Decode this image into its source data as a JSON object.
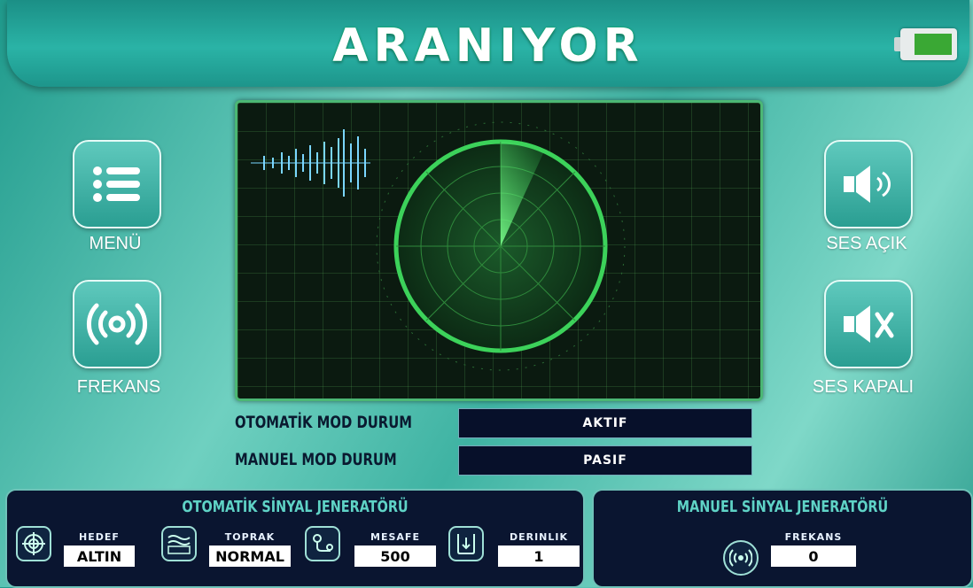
{
  "header": {
    "title": "ARANIYOR"
  },
  "buttons": {
    "menu": "MENÜ",
    "frequency": "FREKANS",
    "sound_on": "SES AÇIK",
    "sound_off": "SES KAPALI"
  },
  "status": {
    "auto_label": "OTOMATİK MOD DURUM",
    "auto_value": "AKTIF",
    "manual_label": "MANUEL MOD DURUM",
    "manual_value": "PASIF"
  },
  "auto_panel": {
    "title": "OTOMATİK SİNYAL JENERATÖRÜ",
    "items": [
      {
        "label": "HEDEF",
        "value": "ALTIN",
        "icon": "target-icon"
      },
      {
        "label": "TOPRAK",
        "value": "NORMAL",
        "icon": "soil-icon"
      },
      {
        "label": "MESAFE",
        "value": "500",
        "icon": "distance-icon"
      },
      {
        "label": "DERINLIK",
        "value": "1",
        "icon": "depth-icon"
      }
    ]
  },
  "manual_panel": {
    "title": "MANUEL SİNYAL JENERATÖRÜ",
    "frequency_label": "FREKANS",
    "frequency_value": "0"
  },
  "colors": {
    "accent": "#2ab3a6",
    "panel": "#0a1530",
    "radar": "#3cd25a"
  }
}
